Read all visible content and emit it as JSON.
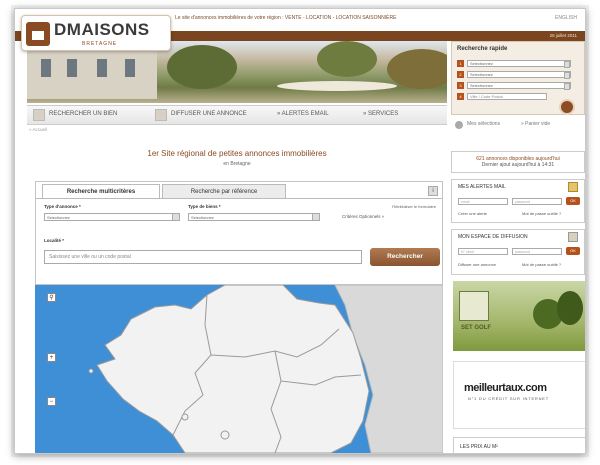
{
  "header": {
    "tagline": "Le site d'annonces immobilières de votre région : VENTE - LOCATION - LOCATION SAISONNIÈRE",
    "lang": "ENGLISH",
    "logo_name": "DMAISONS",
    "logo_sub": "BRETAGNE",
    "date": "26 juillet 2011"
  },
  "quick_search": {
    "title": "Recherche rapide",
    "rows": [
      {
        "num": "1",
        "value": "Selectionnez"
      },
      {
        "num": "2",
        "value": "Selectionnez"
      },
      {
        "num": "3",
        "value": "Selectionnez"
      },
      {
        "num": "4",
        "value": "Ville / Code Postal"
      }
    ]
  },
  "nav": {
    "items": [
      "RECHERCHER UN BIEN",
      "DIFFUSER UNE ANNONCE",
      "» ALERTES EMAIL",
      "» SERVICES"
    ],
    "selection": "Mes sélections",
    "panier": "» Panier vide"
  },
  "breadcrumb": "» Accueil",
  "headline": "1er Site régional de petites annonces immobilières",
  "subhead": "en Bretagne",
  "search_panel": {
    "tabs": [
      "Recherche multicritères",
      "Recherche par référence"
    ],
    "info_icon": "i",
    "reset_link": "Réinitialiser le formulaire",
    "label_type_annonce": "Type d'annonce *",
    "label_type_bien": "Type de biens *",
    "type_annonce_value": "Selectionnez",
    "type_bien_value": "Selectionnez",
    "criteres": "Critères Optionnels »",
    "label_localite": "Localité *",
    "localite_placeholder": "Saisissez une ville ou un code postal",
    "search_button": "Rechercher"
  },
  "map": {
    "controls": [
      "⚲",
      "+",
      "−"
    ]
  },
  "sidebar": {
    "count_line1": "621 annonces disponibles aujourd'hui",
    "count_line2": "Dernier ajout aujourd'hui à 14:31",
    "alertes": {
      "title": "Mes alertes mail",
      "email_ph": "email",
      "pass_ph": "password",
      "ok": "OK",
      "create": "Créer une alerte",
      "forgot": "Mot de passe oublié ?"
    },
    "diffusion": {
      "title": "Mon espace de diffusion",
      "email_ph": "N° client",
      "pass_ph": "password",
      "ok": "OK",
      "create": "Diffuser une annonce",
      "forgot": "Mot de passe oublié ?"
    },
    "ad_golf": "SET GOLF",
    "ad_meil_brand": "meilleurtaux.com",
    "ad_meil_tag": "N°1 DU CRÉDIT SUR INTERNET",
    "prix_title": "LES PRIX AU M²"
  },
  "colors": {
    "brand_brown": "#7b4520",
    "accent_orange": "#b5521c",
    "map_sea": "#3f8fd6"
  }
}
